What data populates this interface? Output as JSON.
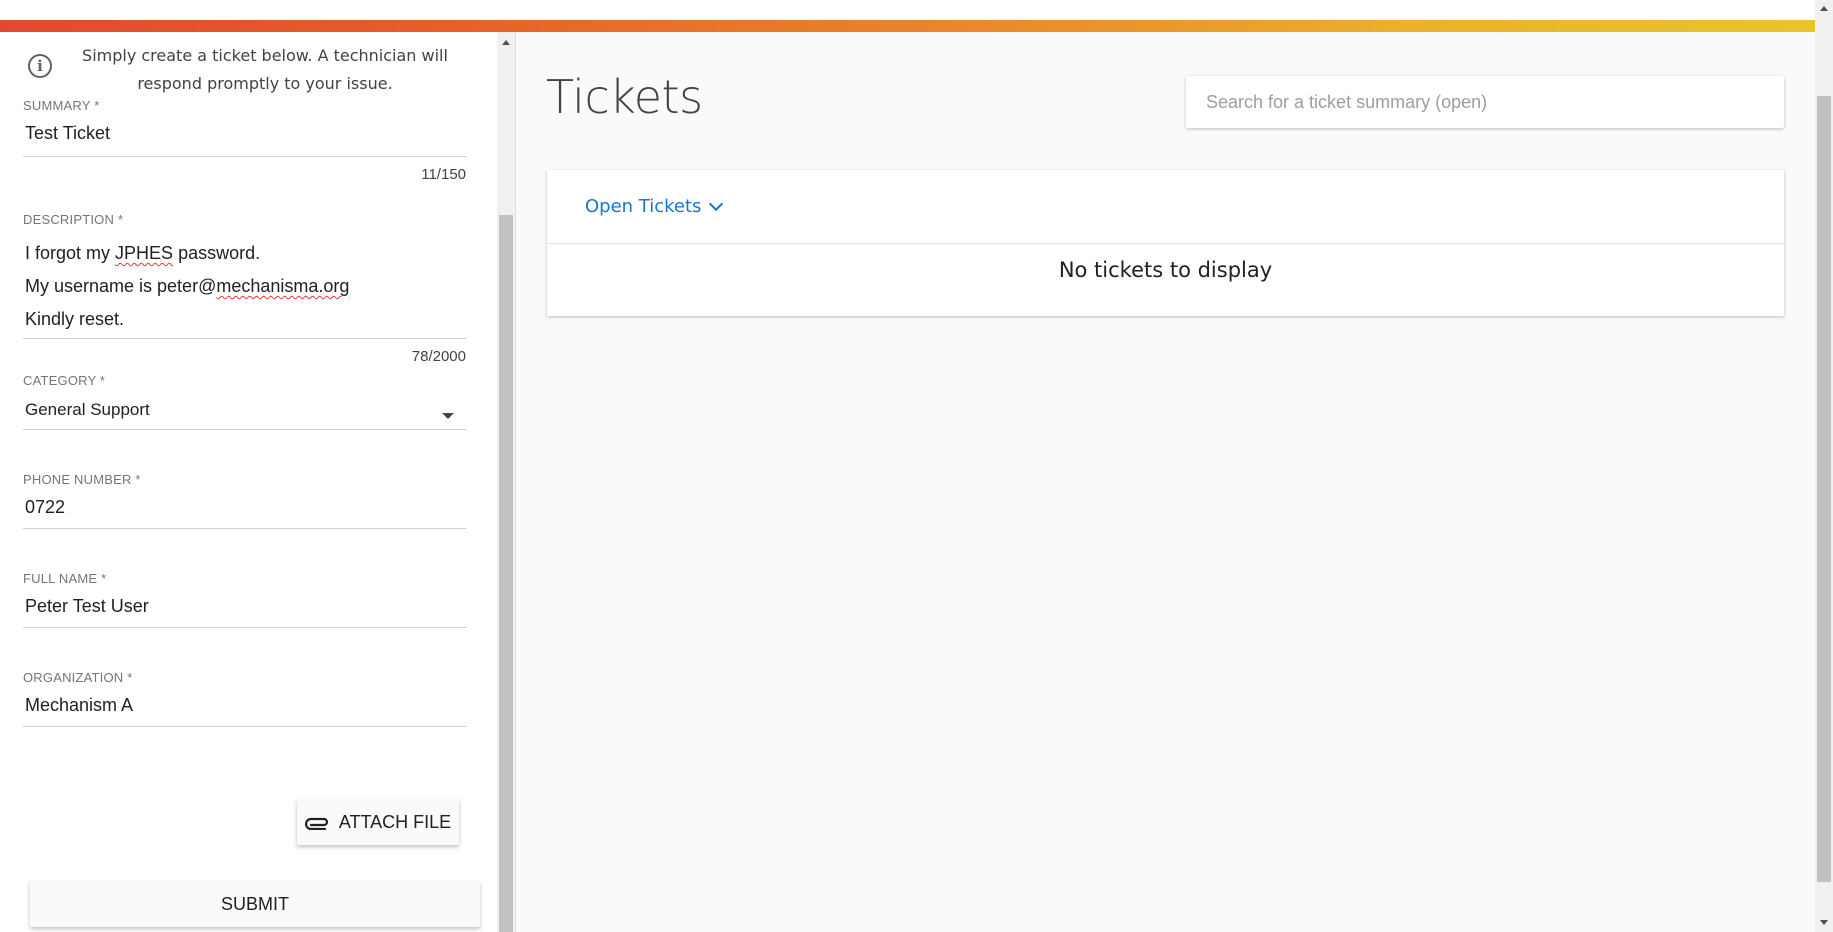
{
  "brand": {
    "gradient_colors": [
      "#e24a2f",
      "#e98a2c",
      "#e8c42b"
    ]
  },
  "form": {
    "info_text": "Simply create a ticket below. A technician will respond promptly to your issue.",
    "info_icon": "info-icon",
    "summary": {
      "label": "SUMMARY *",
      "value": "Test Ticket",
      "counter": "11/150"
    },
    "description": {
      "label": "DESCRIPTION *",
      "line1_pre": "I forgot my ",
      "line1_misspelled": "JPHES",
      "line1_post": " password.",
      "line2_pre": "My username is peter@",
      "line2_misspelled": "mechanisma.org",
      "line3": "Kindly reset.",
      "counter": "78/2000"
    },
    "category": {
      "label": "CATEGORY *",
      "value": "General Support"
    },
    "phone": {
      "label": "PHONE NUMBER *",
      "value": "0722"
    },
    "full_name": {
      "label": "FULL NAME *",
      "value": "Peter Test User"
    },
    "organization": {
      "label": "ORGANIZATION *",
      "value": "Mechanism A"
    },
    "attach_label": "ATTACH FILE",
    "attach_icon": "paperclip-icon",
    "submit_label": "SUBMIT"
  },
  "main": {
    "title": "Tickets",
    "search_placeholder": "Search for a ticket summary (open)",
    "filter_label": "Open Tickets",
    "filter_icon": "chevron-down-icon",
    "accent_color": "#1976d2",
    "empty_message": "No tickets to display"
  }
}
